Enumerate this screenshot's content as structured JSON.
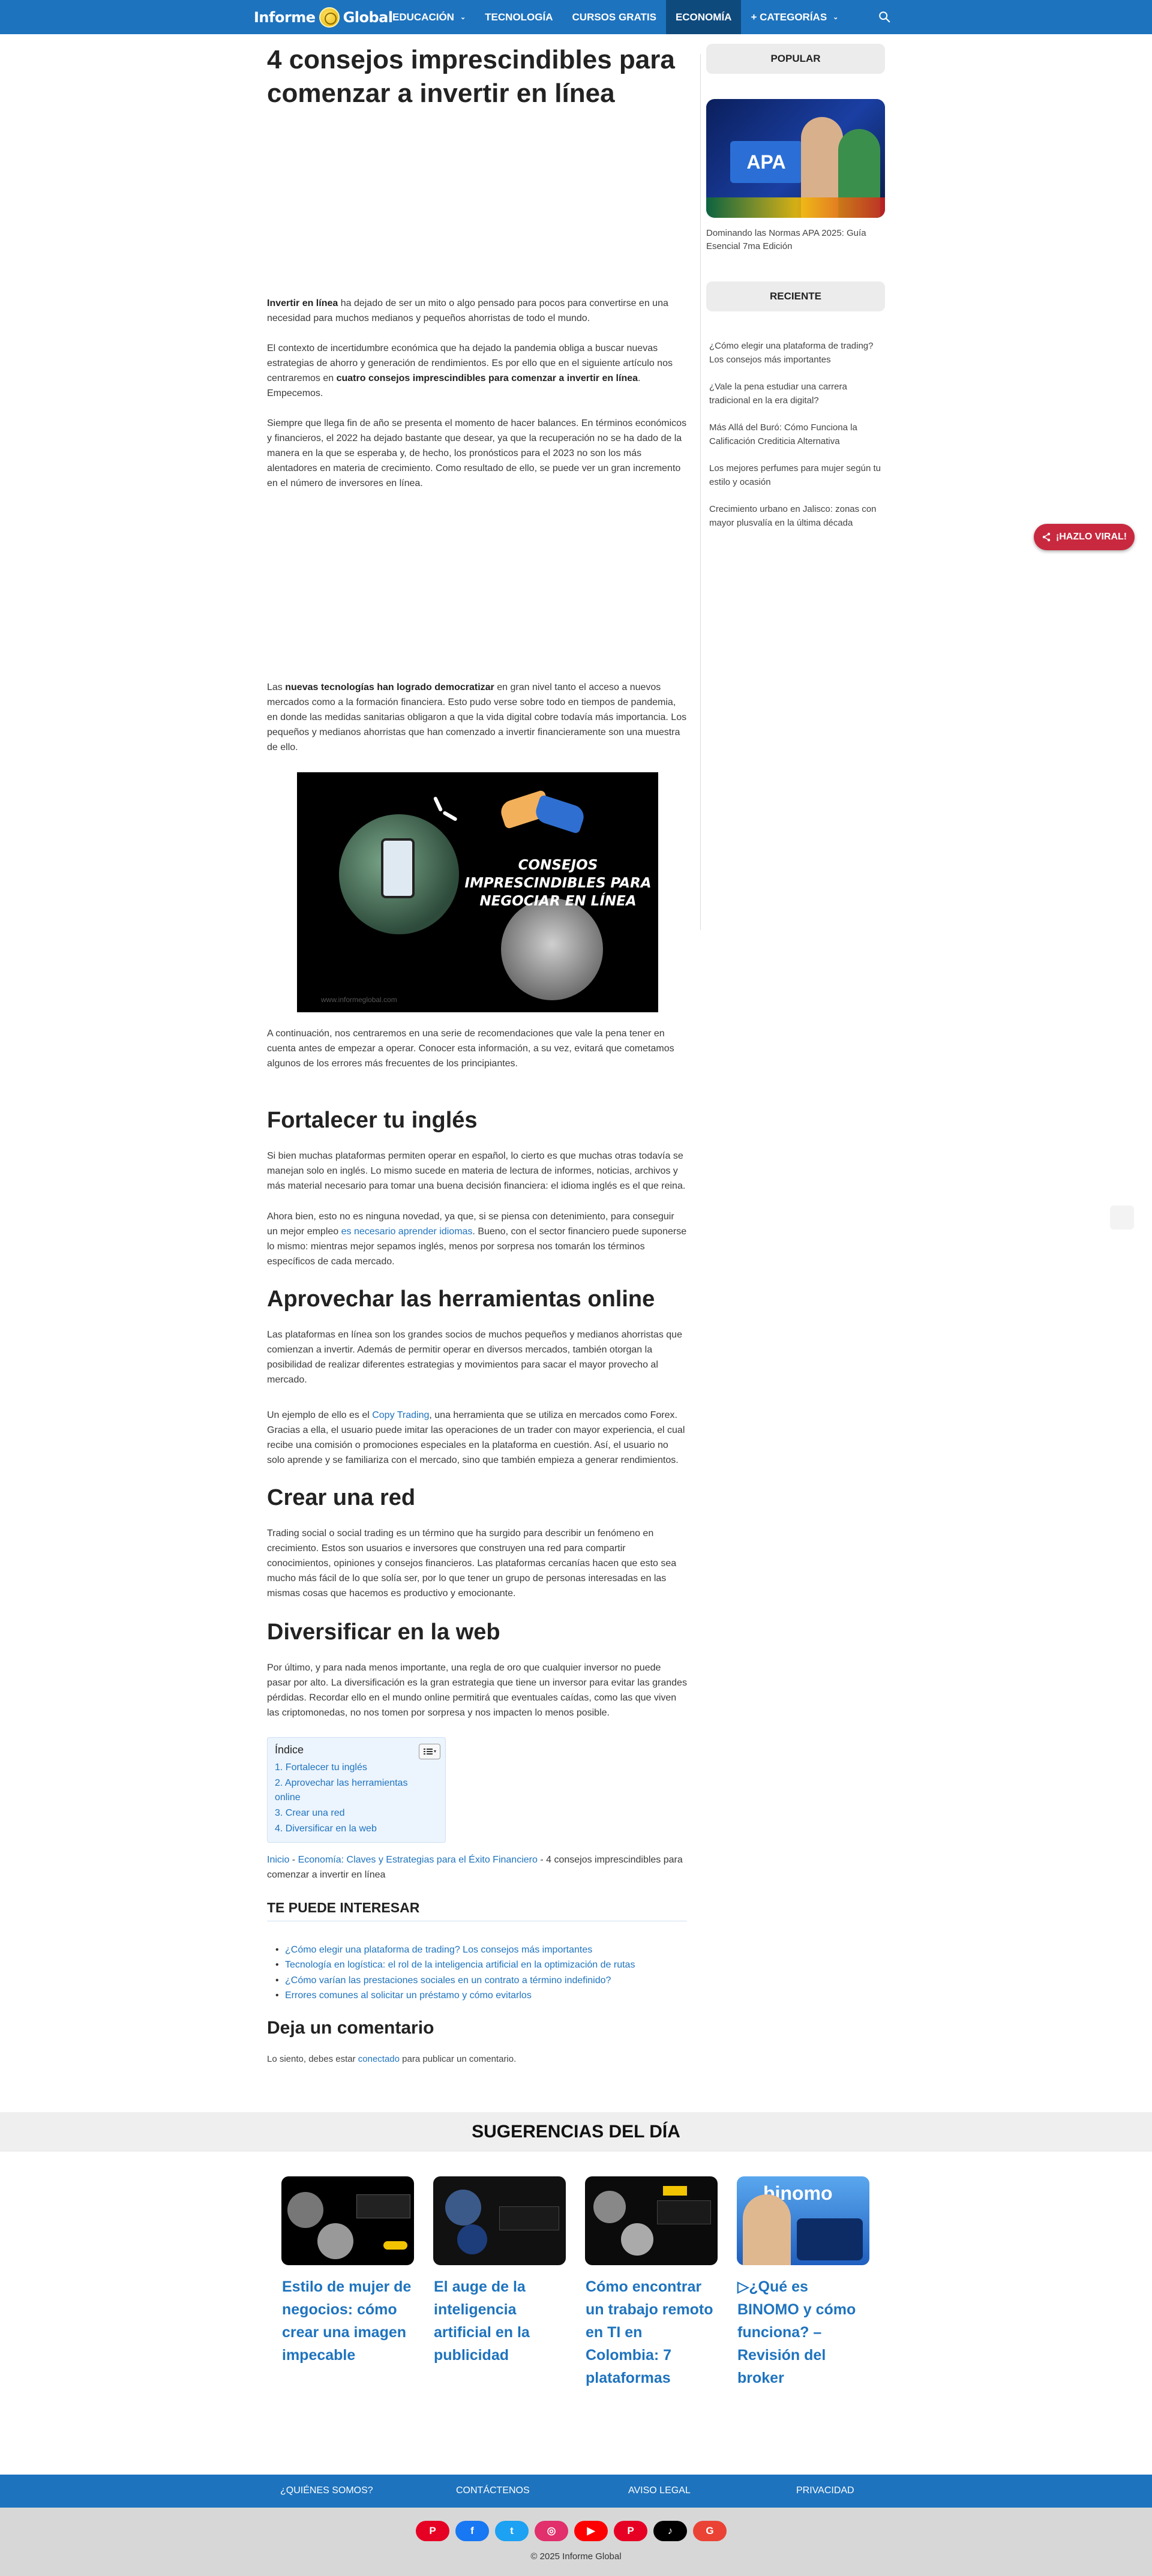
{
  "header": {
    "logo_text": "Informe Global",
    "nav": [
      {
        "label": "EDUCACIÓN",
        "has_caret": true
      },
      {
        "label": "TECNOLOGÍA",
        "has_caret": false
      },
      {
        "label": "CURSOS GRATIS",
        "has_caret": false
      },
      {
        "label": "ECONOMÍA",
        "has_caret": false,
        "active": true
      },
      {
        "label": "+ CATEGORÍAS",
        "has_caret": true
      }
    ],
    "caret": "⌄"
  },
  "article": {
    "title": "4 consejos imprescindibles para comenzar a invertir en línea",
    "intro_bold": "Invertir en línea",
    "intro_rest": " ha dejado de ser un mito o algo pensado para pocos para convertirse en una necesidad para muchos medianos y pequeños ahorristas de todo el mundo.",
    "p2_start": "El contexto de incertidumbre económica que ha dejado la pandemia obliga a buscar nuevas estrategias de ahorro y generación de rendimientos. Es por ello que en el siguiente artículo nos centraremos en ",
    "p2_bold": "cuatro consejos imprescindibles para comenzar a invertir en línea",
    "p2_end": ". Empecemos.",
    "p3": "Siempre que llega fin de año se presenta el momento de hacer balances. En términos económicos y financieros, el 2022 ha dejado bastante que desear, ya que la recuperación no se ha dado de la manera en la que se esperaba y, de hecho, los pronósticos para el 2023 no son los más alentadores en materia de crecimiento. Como resultado de ello, se puede ver un gran incremento en el número de inversores en línea.",
    "p4_start": "Las ",
    "p4_bold": "nuevas tecnologías han logrado democratizar",
    "p4_end": " en gran nivel tanto el acceso a nuevos mercados como a la formación financiera. Esto pudo verse sobre todo en tiempos de pandemia, en donde las medidas sanitarias obligaron a que la vida digital cobre todavía más importancia. Los pequeños y medianos ahorristas que han comenzado a invertir financieramente son una muestra de ello.",
    "image_text": "CONSEJOS IMPRESCINDIBLES PARA NEGOCIAR EN LÍNEA",
    "image_watermark": "www.informeglobal.com",
    "p5": "A continuación, nos centraremos en una serie de recomendaciones que vale la pena tener en cuenta antes de empezar a operar. Conocer esta información, a su vez, evitará que cometamos algunos de los errores más frecuentes de los principiantes.",
    "h_ingles": "Fortalecer tu inglés",
    "p6": "Si bien muchas plataformas permiten operar en español, lo cierto es que muchas otras todavía se manejan solo en inglés. Lo mismo sucede en materia de lectura de informes, noticias, archivos y más material necesario para tomar una buena decisión financiera: el idioma inglés es el que reina.",
    "p7_start": "Ahora bien, esto no es ninguna novedad, ya que, si se piensa con detenimiento, para conseguir un mejor empleo ",
    "p7_link": "es necesario aprender idiomas",
    "p7_end": ". Bueno, con el sector financiero puede suponerse lo mismo: mientras mejor sepamos inglés, menos por sorpresa nos tomarán los términos específicos de cada mercado.",
    "h_herramientas": "Aprovechar las herramientas online",
    "p8": "Las plataformas en línea son los grandes socios de muchos pequeños y medianos ahorristas que comienzan a invertir. Además de permitir operar en diversos mercados, también otorgan la posibilidad de realizar diferentes estrategias y movimientos para sacar el mayor provecho al mercado.",
    "p9_start": "Un ejemplo de ello es el ",
    "p9_link": "Copy Trading",
    "p9_end": ", una herramienta que se utiliza en mercados como Forex. Gracias a ella, el usuario puede imitar las operaciones de un trader con mayor experiencia, el cual recibe una comisión o promociones especiales en la plataforma en cuestión. Así, el usuario no solo aprende y se familiariza con el mercado, sino que también empieza a generar rendimientos.",
    "h_red": "Crear una red",
    "p10": "Trading social o social trading es un término que ha surgido para describir un fenómeno en crecimiento. Estos son usuarios e inversores que construyen una red para compartir conocimientos, opiniones y consejos financieros. Las plataformas cercanías hacen que esto sea mucho más fácil de lo que solía ser, por lo que tener un grupo de personas interesadas en las mismas cosas que hacemos es productivo y emocionante.",
    "h_web": "Diversificar en la web",
    "p11": "Por último, y para nada menos importante, una regla de oro que cualquier inversor no puede pasar por alto. La diversificación es la gran estrategia que tiene un inversor para evitar las grandes pérdidas. Recordar ello en el mundo online permitirá que eventuales caídas, como las que viven las criptomonedas, no nos tomen por sorpresa y nos impacten lo menos posible."
  },
  "toc": {
    "title": "Índice",
    "items": [
      "1. Fortalecer tu inglés",
      "2. Aprovechar las herramientas online",
      "3. Crear una red",
      "4. Diversificar en la web"
    ]
  },
  "breadcrumb": {
    "home": "Inicio",
    "sep": " - ",
    "category": "Economía: Claves y Estrategias para el Éxito Financiero",
    "current": "4 consejos imprescindibles para comenzar a invertir en línea"
  },
  "related": {
    "title": "TE PUEDE INTERESAR",
    "items": [
      "¿Cómo elegir una plataforma de trading? Los consejos más importantes",
      "Tecnología en logística: el rol de la inteligencia artificial en la optimización de rutas",
      "¿Cómo varían las prestaciones sociales en un contrato a término indefinido?",
      "Errores comunes al solicitar un préstamo y cómo evitarlos"
    ]
  },
  "comments": {
    "title": "Deja un comentario",
    "text_start": "Lo siento, debes estar ",
    "link": "conectado",
    "text_end": " para publicar un comentario."
  },
  "sidebar": {
    "popular_title": "POPULAR",
    "popular_image_label": "APA",
    "popular_link": "Dominando las Normas APA 2025: Guía Esencial 7ma Edición",
    "recent_title": "RECIENTE",
    "recent": [
      "¿Cómo elegir una plataforma de trading? Los consejos más importantes",
      "¿Vale la pena estudiar una carrera tradicional en la era digital?",
      "Más Allá del Buró: Cómo Funciona la Calificación Crediticia Alternativa",
      "Los mejores perfumes para mujer según tu estilo y ocasión",
      "Crecimiento urbano en Jalisco: zonas con mayor plusvalía en la última década"
    ]
  },
  "viral": {
    "label": "¡HAZLO VIRAL!",
    "icon": "share-icon"
  },
  "suggestions": {
    "title": "SUGERENCIAS DEL DÍA",
    "cards": [
      {
        "title": "Estilo de mujer de negocios: cómo crear una imagen impecable",
        "color": "#000000"
      },
      {
        "title": "El auge de la inteligencia artificial en la publicidad",
        "color": "#111111"
      },
      {
        "title": "Cómo encontrar un trabajo remoto en TI en Colombia: 7 plataformas",
        "color": "#0b0b0b"
      },
      {
        "title": "▷¿Qué es BINOMO y cómo funciona? – Revisión del broker",
        "color": "#3b8be0",
        "brand": "binomo"
      }
    ]
  },
  "footer": {
    "links": [
      "¿QUIÉNES SOMOS?",
      "CONTÁCTENOS",
      "AVISO LEGAL",
      "PRIVACIDAD"
    ],
    "social": [
      {
        "name": "pinterest-icon",
        "glyph": "P",
        "color": "#e60023"
      },
      {
        "name": "facebook-icon",
        "glyph": "f",
        "color": "#1877f2"
      },
      {
        "name": "twitter-icon",
        "glyph": "t",
        "color": "#1da1f2"
      },
      {
        "name": "instagram-icon",
        "glyph": "◎",
        "color": "#e1306c"
      },
      {
        "name": "youtube-icon",
        "glyph": "▶",
        "color": "#ff0000"
      },
      {
        "name": "pinterest-icon-2",
        "glyph": "P",
        "color": "#e60023"
      },
      {
        "name": "tiktok-icon",
        "glyph": "♪",
        "color": "#000000"
      },
      {
        "name": "google-icon",
        "glyph": "G",
        "color": "#ea4335"
      }
    ],
    "copyright": "© 2025 Informe Global"
  },
  "colors": {
    "brand": "#1e73be",
    "viral": "#c8293f"
  }
}
